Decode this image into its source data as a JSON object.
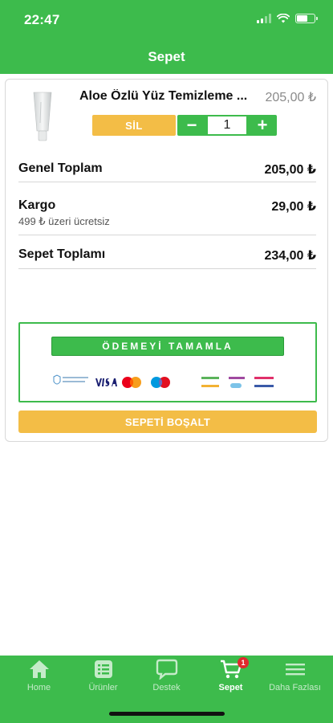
{
  "status_bar": {
    "time": "22:47"
  },
  "header": {
    "title": "Sepet"
  },
  "cart_item": {
    "name": "Aloe Özlü Yüz Temizleme ...",
    "price": "205,00 ₺",
    "delete_label": "SİL",
    "quantity": "1",
    "minus_glyph": "−",
    "plus_glyph": "+"
  },
  "summary": {
    "general_total_label": "Genel Toplam",
    "general_total_value": "205,00 ₺",
    "shipping_label": "Kargo",
    "shipping_value": "29,00 ₺",
    "shipping_note": "499 ₺ üzeri ücretsiz",
    "cart_total_label": "Sepet Toplamı",
    "cart_total_value": "234,00 ₺"
  },
  "payment": {
    "complete_label": "ÖDEMEYİ TAMAMLA",
    "logos": [
      "visa",
      "mastercard",
      "maestro",
      "bonus",
      "world",
      "maximum",
      "axess",
      "paraf",
      "cardfinans"
    ]
  },
  "clear_cart_label": "SEPETİ BOŞALT",
  "tabbar": {
    "items": [
      {
        "label": "Home",
        "icon": "home-icon"
      },
      {
        "label": "Ürünler",
        "icon": "list-icon"
      },
      {
        "label": "Destek",
        "icon": "chat-icon"
      },
      {
        "label": "Sepet",
        "icon": "cart-icon",
        "badge": "1",
        "active": true
      },
      {
        "label": "Daha Fazlası",
        "icon": "menu-icon"
      }
    ]
  },
  "colors": {
    "primary": "#3dbb4c",
    "accent": "#f3bd46",
    "badge": "#e0292d"
  }
}
